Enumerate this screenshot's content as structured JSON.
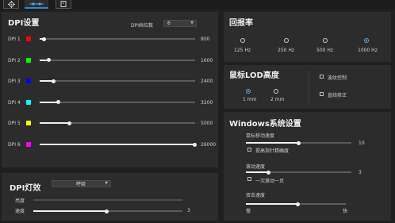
{
  "toolbar": {
    "icons": [
      "gear-icon",
      "dpi-sliders-icon",
      "document-icon"
    ]
  },
  "dpi": {
    "title": "DPI设置",
    "levels_label": "DPI档位数",
    "levels_value": "6",
    "rows": [
      {
        "label": "DPI 1",
        "color": "#ff0000",
        "value": "800"
      },
      {
        "label": "DPI 2",
        "color": "#00ff00",
        "value": "1600"
      },
      {
        "label": "DPI 3",
        "color": "#0000ff",
        "value": "2400"
      },
      {
        "label": "DPI 4",
        "color": "#00ffff",
        "value": "3200"
      },
      {
        "label": "DPI 5",
        "color": "#ffff00",
        "value": "5000"
      },
      {
        "label": "DPI 6",
        "color": "#ff00ff",
        "value": "26000"
      }
    ]
  },
  "report": {
    "title": "回报率",
    "options": [
      "125 Hz",
      "250 Hz",
      "500 Hz",
      "1000 Hz"
    ],
    "selected": "1000 Hz"
  },
  "lod": {
    "title": "鼠标LOD高度",
    "options": [
      "1 mm",
      "2 mm"
    ],
    "selected": "1 mm",
    "checks": [
      "波纹控制",
      "直线修正"
    ]
  },
  "windows": {
    "title": "Windows系统设置",
    "speed_label": "鼠标移动速度",
    "speed_value": "10",
    "precision_label": "提高指针精确度",
    "scroll_label": "滚动速度",
    "scroll_value": "3",
    "scroll_page_label": "一次滚动一页",
    "dbl_label": "双击速度",
    "dbl_slow": "慢",
    "dbl_fast": "快"
  },
  "light": {
    "title": "DPI灯效",
    "mode": "呼吸",
    "brightness_label": "亮度",
    "speed_label": "速度",
    "speed_value": "3"
  }
}
